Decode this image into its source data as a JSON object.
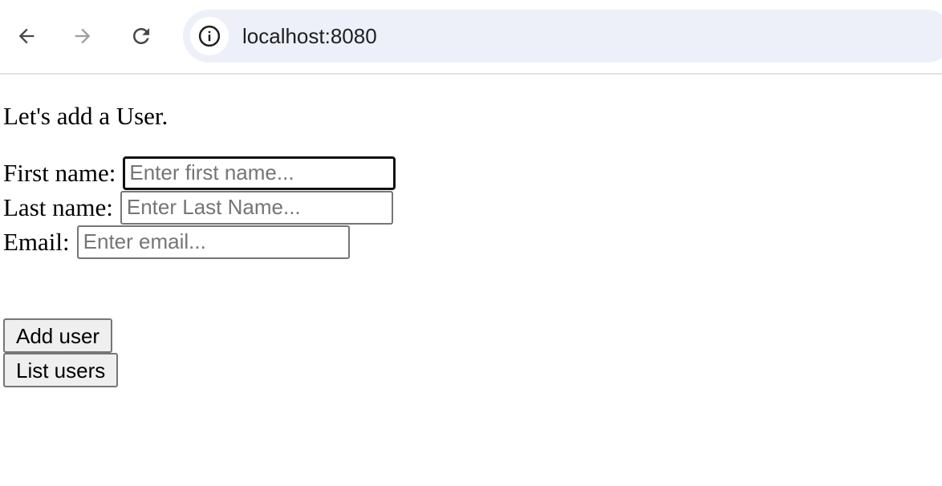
{
  "browser": {
    "url": "localhost:8080",
    "icons": {
      "back": "arrow-left-icon",
      "forward": "arrow-right-icon",
      "reload": "reload-icon",
      "site_info": "info-icon"
    },
    "colors": {
      "omnibox": "#edf0f9",
      "forward_disabled": "#9e9e9e"
    }
  },
  "page": {
    "heading": "Let's add a User.",
    "form": {
      "first_name": {
        "label": "First name:",
        "value": "",
        "placeholder": "Enter first name..."
      },
      "last_name": {
        "label": "Last name:",
        "value": "",
        "placeholder": "Enter Last Name..."
      },
      "email": {
        "label": "Email:",
        "value": "",
        "placeholder": "Enter email..."
      }
    },
    "buttons": {
      "add_user": "Add user",
      "list_users": "List users"
    }
  }
}
